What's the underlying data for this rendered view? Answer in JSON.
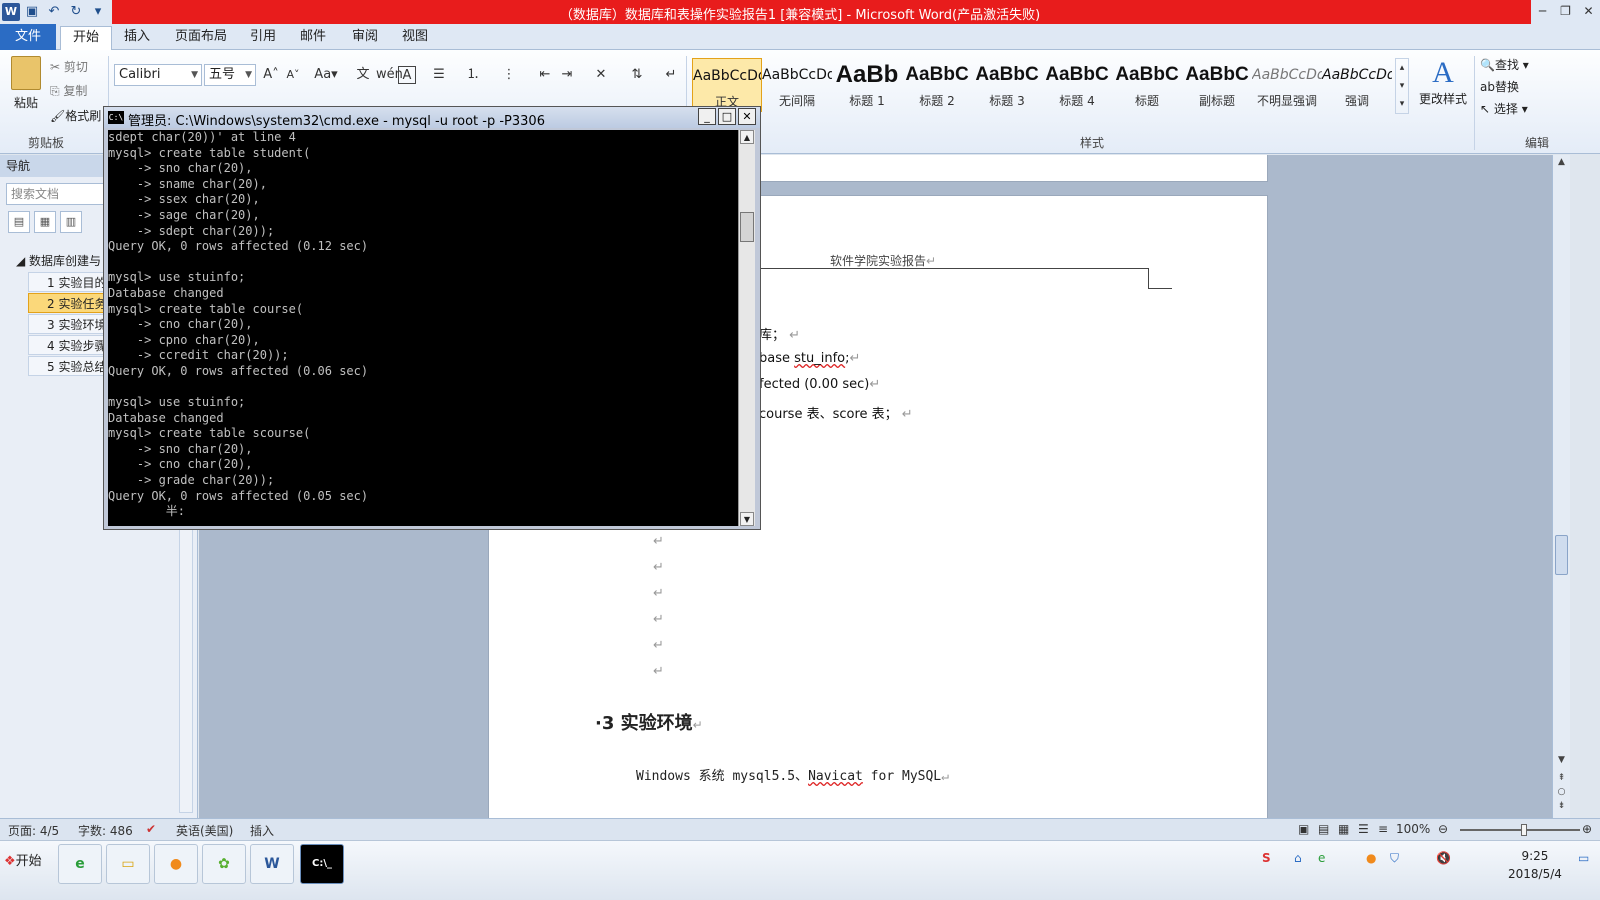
{
  "window": {
    "title": "（数据库）数据库和表操作实验报告1 [兼容模式] - Microsoft Word(产品激活失败)",
    "qat_icons": [
      "word-logo-icon",
      "save-icon",
      "undo-icon",
      "redo-icon",
      "customize-icon"
    ],
    "winctl": [
      "─",
      "❐",
      "✕"
    ]
  },
  "ribbon_tabs": [
    "文件",
    "开始",
    "插入",
    "页面布局",
    "引用",
    "邮件",
    "审阅",
    "视图"
  ],
  "ribbon": {
    "clipboard": {
      "paste": "粘贴",
      "cut": "剪切",
      "copy": "复制",
      "format_painter": "格式刷",
      "label": "剪贴板"
    },
    "font": {
      "name": "Calibri",
      "size": "五号",
      "grow": "A",
      "shrink": "A",
      "case": "Aa"
    },
    "styles": [
      {
        "sample": "AaBbCcDd",
        "name": "正文"
      },
      {
        "sample": "AaBbCcDd",
        "name": "无间隔"
      },
      {
        "sample": "AaBb",
        "name": "标题 1"
      },
      {
        "sample": "AaBbC",
        "name": "标题 2"
      },
      {
        "sample": "AaBbC",
        "name": "标题 3"
      },
      {
        "sample": "AaBbC",
        "name": "标题 4"
      },
      {
        "sample": "AaBbC",
        "name": "标题"
      },
      {
        "sample": "AaBbC",
        "name": "副标题"
      },
      {
        "sample": "AaBbCcDd",
        "name": "不明显强调"
      },
      {
        "sample": "AaBbCcDd",
        "name": "强调"
      }
    ],
    "styles_label": "样式",
    "change_styles": "更改样式",
    "editing": {
      "find": "查找",
      "replace": "替换",
      "select": "选择",
      "label": "编辑"
    }
  },
  "nav_pane": {
    "title": "导航",
    "search_placeholder": "搜索文档",
    "root": "数据库创建与",
    "items": [
      "1 实验目的",
      "2 实验任务",
      "3 实验环境",
      "4 实验步骤",
      "5 实验总结"
    ],
    "active_index": 1
  },
  "document": {
    "header": "软件学院实验报告",
    "lines": [
      {
        "text": "库；"
      },
      {
        "pre": "base ",
        "u": "stu_info",
        "post": ";"
      },
      {
        "text": "fected (0.00 sec)"
      },
      {
        "text": "course 表、score 表；"
      }
    ],
    "heading": "·3  实验环境",
    "env_pre": "Windows 系统 mysql5.5、",
    "env_u": "Navicat",
    "env_post": " for MySQL"
  },
  "cmd": {
    "title": "管理员: C:\\Windows\\system32\\cmd.exe - mysql  -u root -p -P3306",
    "console": "sdept char(20))' at line 4\nmysql> create table student(\n    -> sno char(20),\n    -> sname char(20),\n    -> ssex char(20),\n    -> sage char(20),\n    -> sdept char(20));\nQuery OK, 0 rows affected (0.12 sec)\n\nmysql> use stuinfo;\nDatabase changed\nmysql> create table course(\n    -> cno char(20),\n    -> cpno char(20),\n    -> ccredit char(20));\nQuery OK, 0 rows affected (0.06 sec)\n\nmysql> use stuinfo;\nDatabase changed\nmysql> create table scourse(\n    -> sno char(20),\n    -> cno char(20),\n    -> grade char(20));\nQuery OK, 0 rows affected (0.05 sec)\n        半:"
  },
  "status_bar": {
    "page": "页面: 4/5",
    "words": "字数: 486",
    "language": "英语(美国)",
    "mode": "插入",
    "zoom": "100%"
  },
  "taskbar": {
    "start": "开始",
    "time": "9:25",
    "date": "2018/5/4"
  }
}
